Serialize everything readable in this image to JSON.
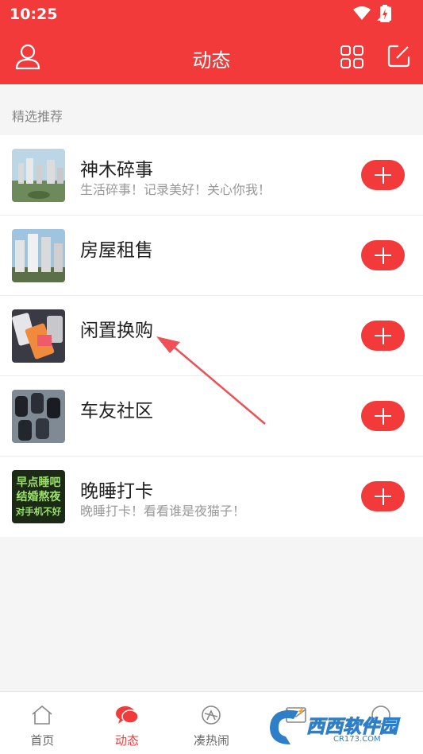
{
  "status_bar": {
    "time": "10:25"
  },
  "app_bar": {
    "title": "动态"
  },
  "section": {
    "label": "精选推荐"
  },
  "items": [
    {
      "title": "神木碎事",
      "subtitle": "生活碎事！记录美好！关心你我！"
    },
    {
      "title": "房屋租售",
      "subtitle": ""
    },
    {
      "title": "闲置换购",
      "subtitle": ""
    },
    {
      "title": "车友社区",
      "subtitle": ""
    },
    {
      "title": "晚睡打卡",
      "subtitle": "晚睡打卡！看看谁是夜猫子！",
      "thumb_text": [
        "早点睡吧",
        "结婚熬夜",
        "对手机不好"
      ]
    }
  ],
  "tabs": [
    {
      "label": "首页",
      "icon": "home-icon"
    },
    {
      "label": "动态",
      "icon": "chat-bubbles-icon",
      "active": true
    },
    {
      "label": "凑热闹",
      "icon": "compass-icon"
    },
    {
      "label": "",
      "icon": "mail-icon"
    },
    {
      "label": "",
      "icon": "profile-icon"
    }
  ],
  "watermark": {
    "text": "西西软件园",
    "url": "CR173.COM"
  },
  "colors": {
    "accent": "#f23a3a",
    "background": "#f5f5f5"
  }
}
